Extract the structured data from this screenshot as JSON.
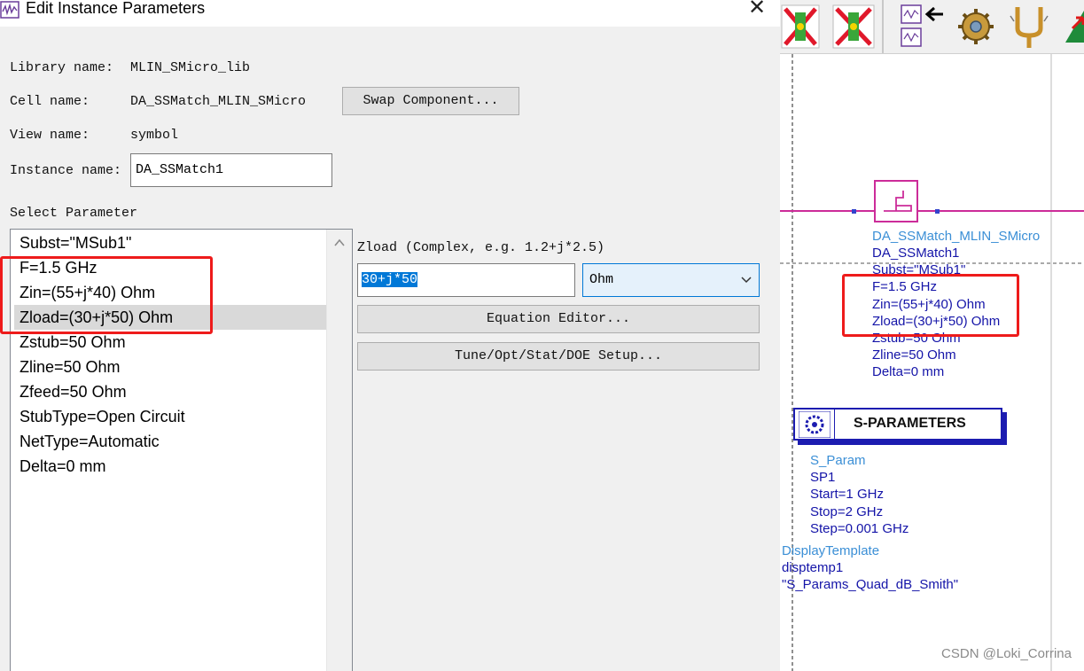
{
  "dialog": {
    "title": "Edit Instance Parameters",
    "close_glyph": "✕",
    "library_label": "Library name:",
    "library_value": "MLIN_SMicro_lib",
    "cell_label": "Cell name:",
    "cell_value": "DA_SSMatch_MLIN_SMicro",
    "swap_button": "Swap Component...",
    "view_label": "View name:",
    "view_value": "symbol",
    "instance_label": "Instance name:",
    "instance_value": "DA_SSMatch1",
    "select_param_label": "Select Parameter",
    "parameters": [
      "Subst=\"MSub1\"",
      "F=1.5 GHz",
      "Zin=(55+j*40) Ohm",
      "Zload=(30+j*50) Ohm",
      "Zstub=50 Ohm",
      "Zline=50 Ohm",
      "Zfeed=50 Ohm",
      "StubType=Open Circuit",
      "NetType=Automatic",
      "Delta=0 mm"
    ],
    "selected_index": 3,
    "zload_label": "Zload (Complex, e.g. 1.2+j*2.5)",
    "zload_value": "30+j*50",
    "unit_value": "Ohm",
    "equation_button": "Equation Editor...",
    "tune_button": "Tune/Opt/Stat/DOE Setup..."
  },
  "schematic": {
    "component_lines": [
      "DA_SSMatch_MLIN_SMicro",
      "DA_SSMatch1",
      "Subst=\"MSub1\"",
      "F=1.5 GHz",
      "Zin=(55+j*40) Ohm",
      "Zload=(30+j*50) Ohm",
      "Zstub=50 Ohm",
      "Zline=50 Ohm",
      "Delta=0 mm"
    ],
    "sparam_title": "S-PARAMETERS",
    "sparam_lines": [
      "S_Param",
      "SP1",
      "Start=1 GHz",
      "Stop=2 GHz",
      "Step=0.001 GHz"
    ],
    "display_lines": [
      "DisplayTemplate",
      "disptemp1",
      "\"S_Params_Quad_dB_Smith\""
    ],
    "watermark": "CSDN @Loki_Corrina"
  },
  "colors": {
    "highlight_red": "#ee1b1b",
    "wire_magenta": "#cc2c99",
    "schematic_text_blue": "#1414a8",
    "schematic_label_blue": "#3b8fd6"
  }
}
